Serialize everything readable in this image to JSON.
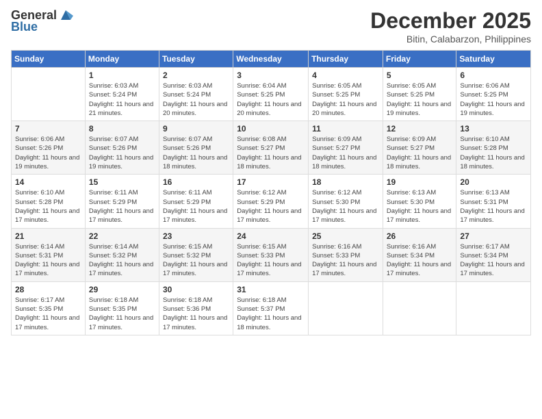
{
  "header": {
    "logo_general": "General",
    "logo_blue": "Blue",
    "month": "December 2025",
    "location": "Bitin, Calabarzon, Philippines"
  },
  "weekdays": [
    "Sunday",
    "Monday",
    "Tuesday",
    "Wednesday",
    "Thursday",
    "Friday",
    "Saturday"
  ],
  "weeks": [
    [
      {
        "day": "",
        "sunrise": "",
        "sunset": "",
        "daylight": ""
      },
      {
        "day": "1",
        "sunrise": "Sunrise: 6:03 AM",
        "sunset": "Sunset: 5:24 PM",
        "daylight": "Daylight: 11 hours and 21 minutes."
      },
      {
        "day": "2",
        "sunrise": "Sunrise: 6:03 AM",
        "sunset": "Sunset: 5:24 PM",
        "daylight": "Daylight: 11 hours and 20 minutes."
      },
      {
        "day": "3",
        "sunrise": "Sunrise: 6:04 AM",
        "sunset": "Sunset: 5:25 PM",
        "daylight": "Daylight: 11 hours and 20 minutes."
      },
      {
        "day": "4",
        "sunrise": "Sunrise: 6:05 AM",
        "sunset": "Sunset: 5:25 PM",
        "daylight": "Daylight: 11 hours and 20 minutes."
      },
      {
        "day": "5",
        "sunrise": "Sunrise: 6:05 AM",
        "sunset": "Sunset: 5:25 PM",
        "daylight": "Daylight: 11 hours and 19 minutes."
      },
      {
        "day": "6",
        "sunrise": "Sunrise: 6:06 AM",
        "sunset": "Sunset: 5:25 PM",
        "daylight": "Daylight: 11 hours and 19 minutes."
      }
    ],
    [
      {
        "day": "7",
        "sunrise": "Sunrise: 6:06 AM",
        "sunset": "Sunset: 5:26 PM",
        "daylight": "Daylight: 11 hours and 19 minutes."
      },
      {
        "day": "8",
        "sunrise": "Sunrise: 6:07 AM",
        "sunset": "Sunset: 5:26 PM",
        "daylight": "Daylight: 11 hours and 19 minutes."
      },
      {
        "day": "9",
        "sunrise": "Sunrise: 6:07 AM",
        "sunset": "Sunset: 5:26 PM",
        "daylight": "Daylight: 11 hours and 18 minutes."
      },
      {
        "day": "10",
        "sunrise": "Sunrise: 6:08 AM",
        "sunset": "Sunset: 5:27 PM",
        "daylight": "Daylight: 11 hours and 18 minutes."
      },
      {
        "day": "11",
        "sunrise": "Sunrise: 6:09 AM",
        "sunset": "Sunset: 5:27 PM",
        "daylight": "Daylight: 11 hours and 18 minutes."
      },
      {
        "day": "12",
        "sunrise": "Sunrise: 6:09 AM",
        "sunset": "Sunset: 5:27 PM",
        "daylight": "Daylight: 11 hours and 18 minutes."
      },
      {
        "day": "13",
        "sunrise": "Sunrise: 6:10 AM",
        "sunset": "Sunset: 5:28 PM",
        "daylight": "Daylight: 11 hours and 18 minutes."
      }
    ],
    [
      {
        "day": "14",
        "sunrise": "Sunrise: 6:10 AM",
        "sunset": "Sunset: 5:28 PM",
        "daylight": "Daylight: 11 hours and 17 minutes."
      },
      {
        "day": "15",
        "sunrise": "Sunrise: 6:11 AM",
        "sunset": "Sunset: 5:29 PM",
        "daylight": "Daylight: 11 hours and 17 minutes."
      },
      {
        "day": "16",
        "sunrise": "Sunrise: 6:11 AM",
        "sunset": "Sunset: 5:29 PM",
        "daylight": "Daylight: 11 hours and 17 minutes."
      },
      {
        "day": "17",
        "sunrise": "Sunrise: 6:12 AM",
        "sunset": "Sunset: 5:29 PM",
        "daylight": "Daylight: 11 hours and 17 minutes."
      },
      {
        "day": "18",
        "sunrise": "Sunrise: 6:12 AM",
        "sunset": "Sunset: 5:30 PM",
        "daylight": "Daylight: 11 hours and 17 minutes."
      },
      {
        "day": "19",
        "sunrise": "Sunrise: 6:13 AM",
        "sunset": "Sunset: 5:30 PM",
        "daylight": "Daylight: 11 hours and 17 minutes."
      },
      {
        "day": "20",
        "sunrise": "Sunrise: 6:13 AM",
        "sunset": "Sunset: 5:31 PM",
        "daylight": "Daylight: 11 hours and 17 minutes."
      }
    ],
    [
      {
        "day": "21",
        "sunrise": "Sunrise: 6:14 AM",
        "sunset": "Sunset: 5:31 PM",
        "daylight": "Daylight: 11 hours and 17 minutes."
      },
      {
        "day": "22",
        "sunrise": "Sunrise: 6:14 AM",
        "sunset": "Sunset: 5:32 PM",
        "daylight": "Daylight: 11 hours and 17 minutes."
      },
      {
        "day": "23",
        "sunrise": "Sunrise: 6:15 AM",
        "sunset": "Sunset: 5:32 PM",
        "daylight": "Daylight: 11 hours and 17 minutes."
      },
      {
        "day": "24",
        "sunrise": "Sunrise: 6:15 AM",
        "sunset": "Sunset: 5:33 PM",
        "daylight": "Daylight: 11 hours and 17 minutes."
      },
      {
        "day": "25",
        "sunrise": "Sunrise: 6:16 AM",
        "sunset": "Sunset: 5:33 PM",
        "daylight": "Daylight: 11 hours and 17 minutes."
      },
      {
        "day": "26",
        "sunrise": "Sunrise: 6:16 AM",
        "sunset": "Sunset: 5:34 PM",
        "daylight": "Daylight: 11 hours and 17 minutes."
      },
      {
        "day": "27",
        "sunrise": "Sunrise: 6:17 AM",
        "sunset": "Sunset: 5:34 PM",
        "daylight": "Daylight: 11 hours and 17 minutes."
      }
    ],
    [
      {
        "day": "28",
        "sunrise": "Sunrise: 6:17 AM",
        "sunset": "Sunset: 5:35 PM",
        "daylight": "Daylight: 11 hours and 17 minutes."
      },
      {
        "day": "29",
        "sunrise": "Sunrise: 6:18 AM",
        "sunset": "Sunset: 5:35 PM",
        "daylight": "Daylight: 11 hours and 17 minutes."
      },
      {
        "day": "30",
        "sunrise": "Sunrise: 6:18 AM",
        "sunset": "Sunset: 5:36 PM",
        "daylight": "Daylight: 11 hours and 17 minutes."
      },
      {
        "day": "31",
        "sunrise": "Sunrise: 6:18 AM",
        "sunset": "Sunset: 5:37 PM",
        "daylight": "Daylight: 11 hours and 18 minutes."
      },
      {
        "day": "",
        "sunrise": "",
        "sunset": "",
        "daylight": ""
      },
      {
        "day": "",
        "sunrise": "",
        "sunset": "",
        "daylight": ""
      },
      {
        "day": "",
        "sunrise": "",
        "sunset": "",
        "daylight": ""
      }
    ]
  ]
}
